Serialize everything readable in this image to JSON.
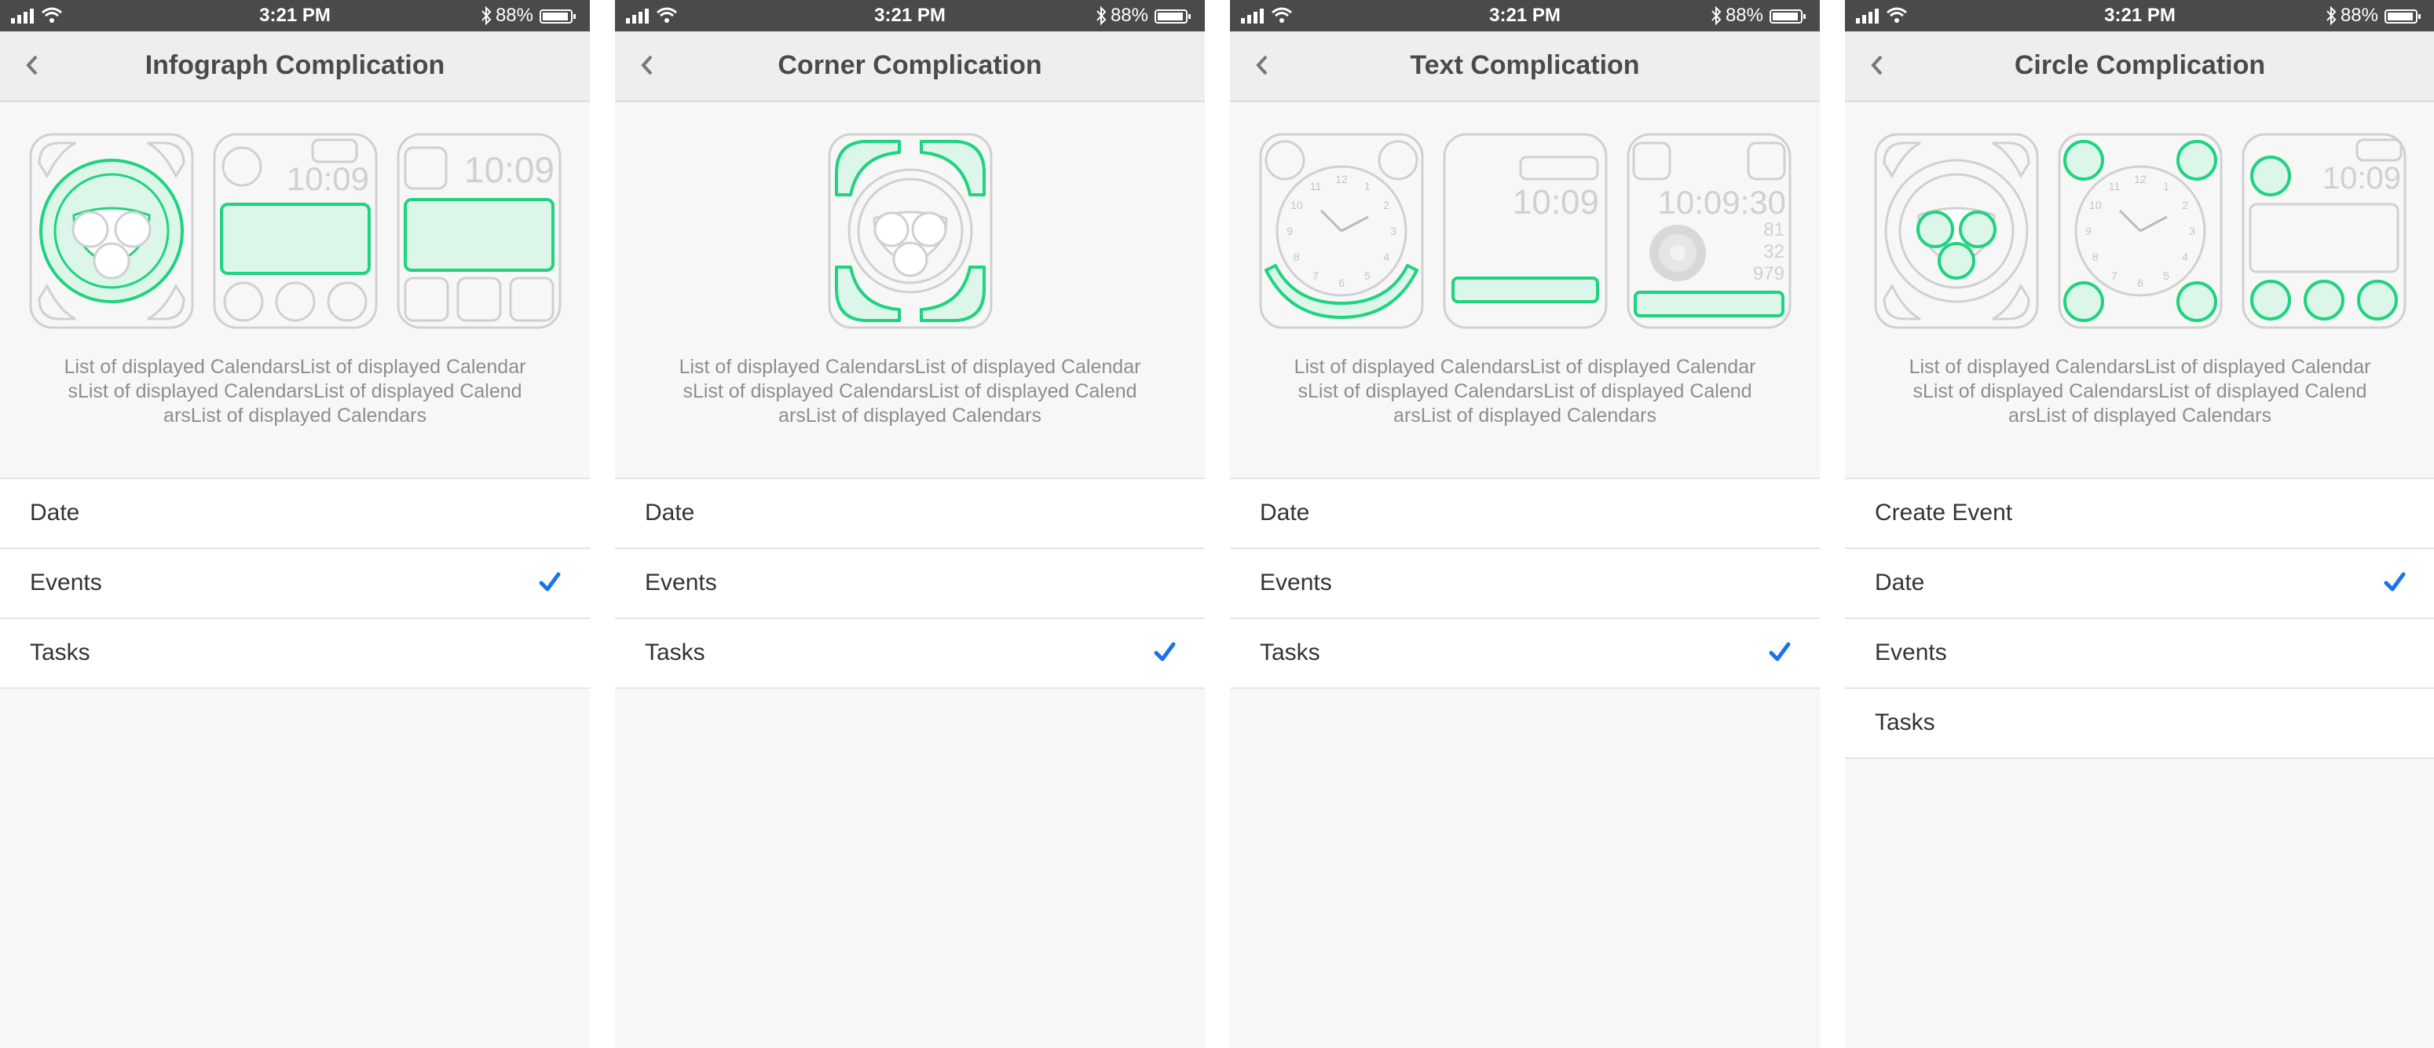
{
  "status_bar": {
    "time": "3:21 PM",
    "battery": "88%"
  },
  "description": "List of displayed CalendarsList of displayed CalendarsList of displayed CalendarsList of displayed CalendarsList of displayed Calendars",
  "screens": [
    {
      "title": "Infograph Complication",
      "watch_times": [
        "10:09",
        "10:09"
      ],
      "options": [
        {
          "label": "Date",
          "checked": false
        },
        {
          "label": "Events",
          "checked": true
        },
        {
          "label": "Tasks",
          "checked": false
        }
      ]
    },
    {
      "title": "Corner Complication",
      "options": [
        {
          "label": "Date",
          "checked": false
        },
        {
          "label": "Events",
          "checked": false
        },
        {
          "label": "Tasks",
          "checked": true
        }
      ]
    },
    {
      "title": "Text Complication",
      "watch_times": [
        "10:09",
        "10:09:30"
      ],
      "watch_values": [
        "81",
        "32",
        "979"
      ],
      "dial_numbers": [
        "12",
        "1",
        "2",
        "3",
        "4",
        "5",
        "6",
        "7",
        "8",
        "9",
        "10",
        "11"
      ],
      "options": [
        {
          "label": "Date",
          "checked": false
        },
        {
          "label": "Events",
          "checked": false
        },
        {
          "label": "Tasks",
          "checked": true
        }
      ]
    },
    {
      "title": "Circle Complication",
      "watch_times": [
        "10:09"
      ],
      "dial_numbers": [
        "12",
        "1",
        "2",
        "3",
        "4",
        "5",
        "6",
        "7",
        "8",
        "9",
        "10",
        "11"
      ],
      "options": [
        {
          "label": "Create Event",
          "checked": false
        },
        {
          "label": "Date",
          "checked": true
        },
        {
          "label": "Events",
          "checked": false
        },
        {
          "label": "Tasks",
          "checked": false
        }
      ]
    }
  ],
  "colors": {
    "accent_green": "#1fd37f",
    "fill_green": "#dcf6ea",
    "check_blue": "#1a73e8",
    "status_bar": "#4a4a4a",
    "nav_bar": "#eeeeee"
  },
  "icons": {
    "back": "chevron-left-icon",
    "check": "checkmark-icon",
    "signal": "signal-icon",
    "wifi": "wifi-icon",
    "bluetooth": "bluetooth-icon",
    "battery": "battery-icon"
  }
}
